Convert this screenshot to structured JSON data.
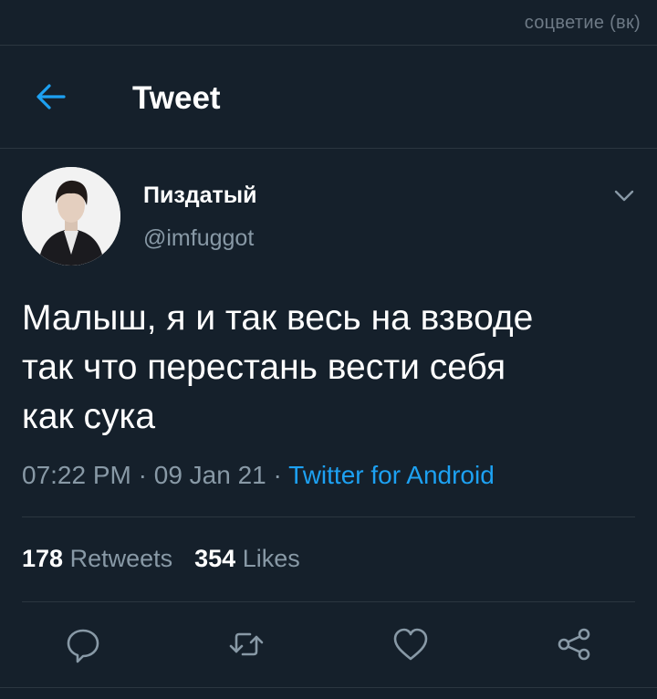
{
  "watermark": "соцветие (вк)",
  "header": {
    "back_icon": "arrow-left-icon",
    "title": "Tweet"
  },
  "tweet": {
    "display_name": "Пиздатый",
    "handle": "@imfuggot",
    "text_lines": [
      "Малыш, я и так весь на взводе",
      "так что перестань вести себя",
      "как сука"
    ],
    "time": "07:22 PM",
    "separator": " · ",
    "date": "09 Jan 21",
    "source": "Twitter for Android"
  },
  "stats": {
    "retweets_count": "178",
    "retweets_label": "Retweets",
    "likes_count": "354",
    "likes_label": "Likes"
  },
  "actions": [
    "reply-icon",
    "retweet-icon",
    "like-icon",
    "share-icon"
  ],
  "colors": {
    "background": "#15202b",
    "accent": "#1da1f2",
    "secondary_text": "#8899a6",
    "divider": "#2b3640"
  }
}
